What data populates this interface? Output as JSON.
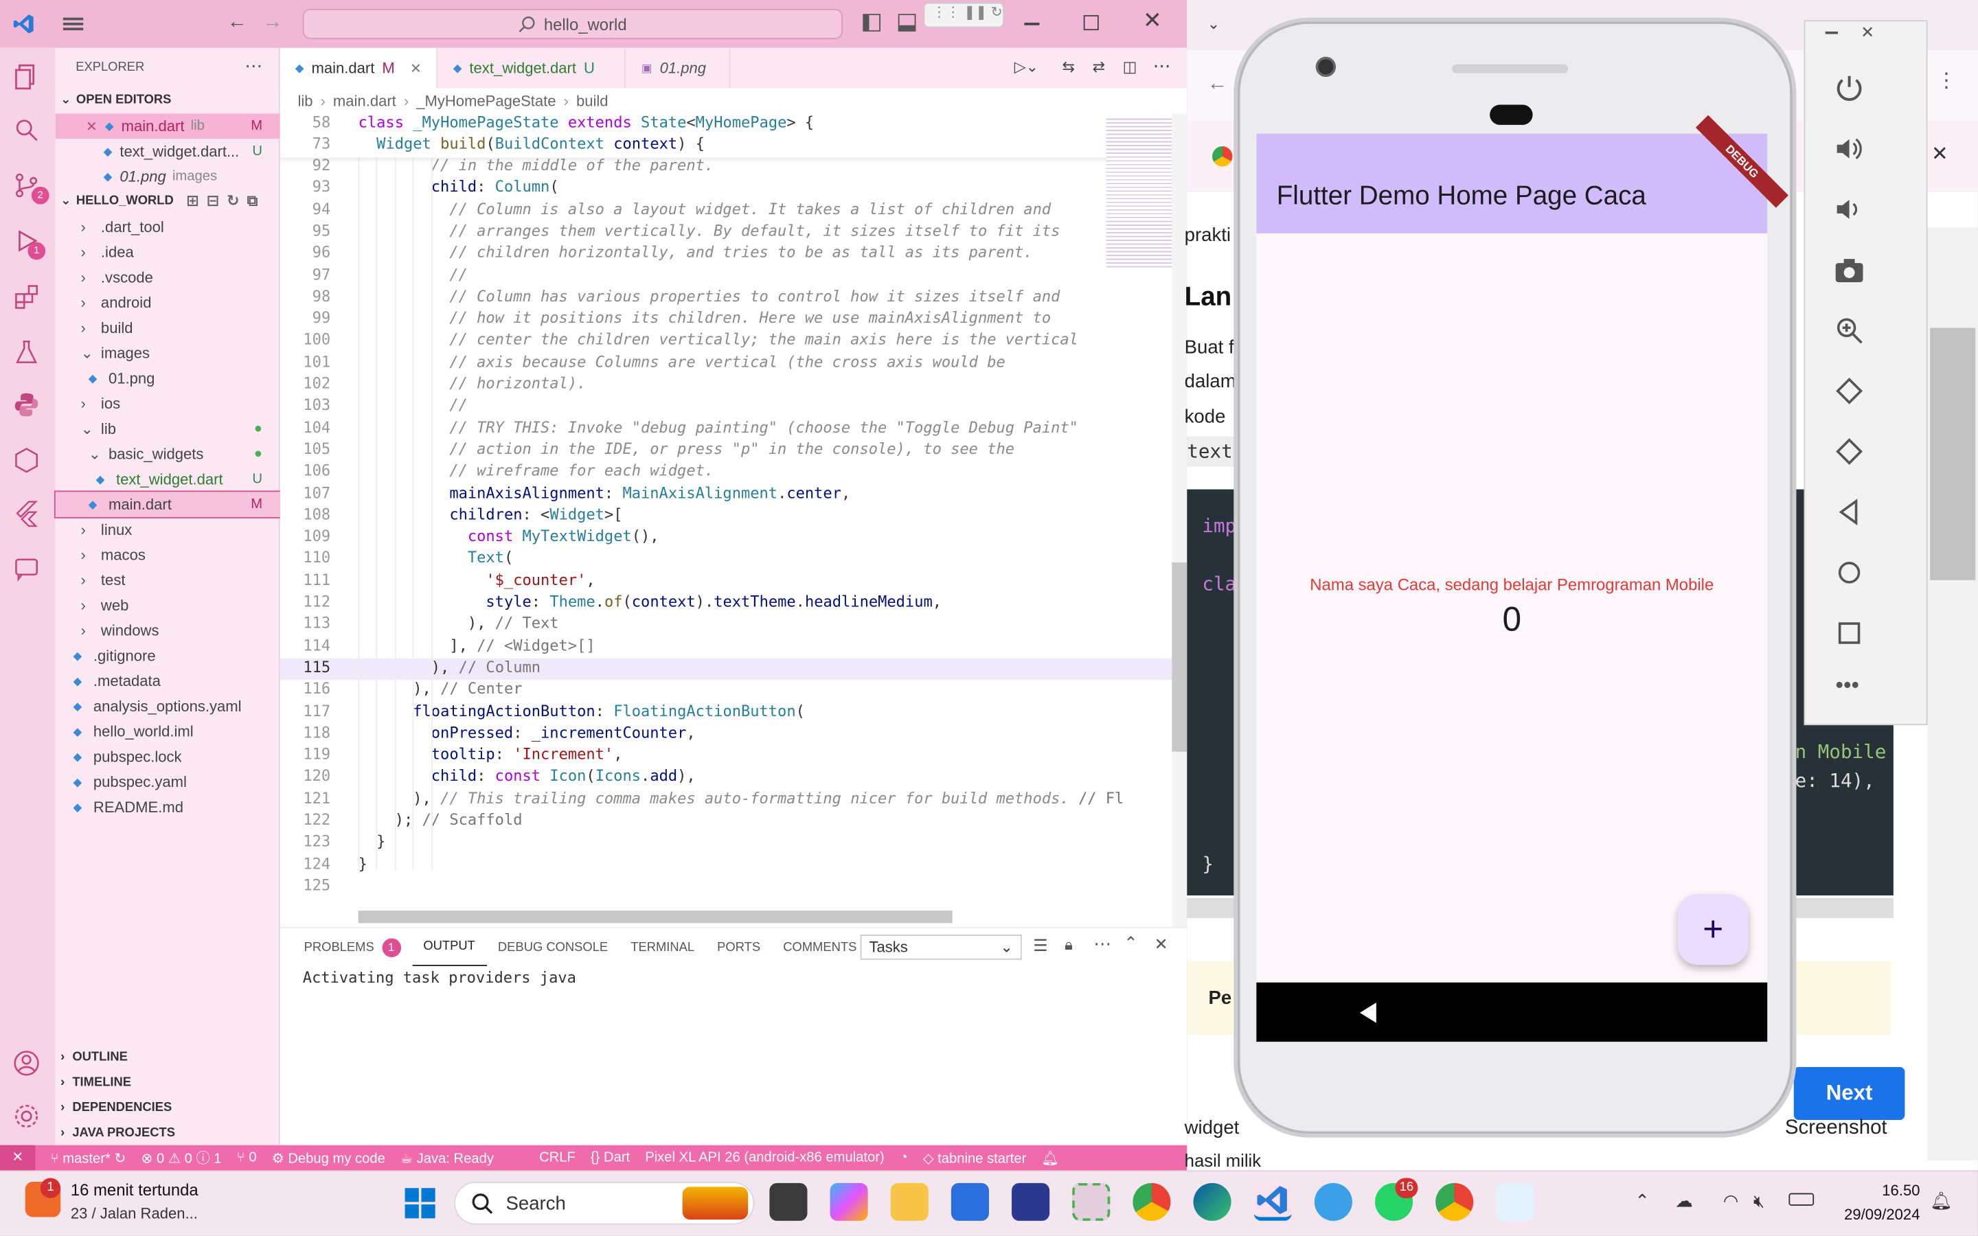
{
  "vscode": {
    "search_text": "hello_world",
    "explorer_title": "EXPLORER",
    "open_editors": {
      "title": "OPEN EDITORS",
      "items": [
        {
          "name": "main.dart",
          "folder": "lib",
          "decoration": "M"
        },
        {
          "name": "text_widget.dart...",
          "folder": "",
          "decoration": "U"
        },
        {
          "name": "01.png",
          "folder": "images",
          "decoration": ""
        }
      ]
    },
    "project": {
      "title": "HELLO_WORLD",
      "items": [
        {
          "name": ".dart_tool",
          "decoration": ""
        },
        {
          "name": ".idea",
          "decoration": ""
        },
        {
          "name": ".vscode",
          "decoration": ""
        },
        {
          "name": "android",
          "decoration": ""
        },
        {
          "name": "build",
          "decoration": ""
        },
        {
          "name": "images",
          "decoration": ""
        },
        {
          "name": "01.png",
          "decoration": ""
        },
        {
          "name": "ios",
          "decoration": ""
        },
        {
          "name": "lib",
          "decoration": "●"
        },
        {
          "name": "basic_widgets",
          "decoration": "●"
        },
        {
          "name": "text_widget.dart",
          "decoration": "U"
        },
        {
          "name": "main.dart",
          "decoration": "M"
        },
        {
          "name": "linux",
          "decoration": ""
        },
        {
          "name": "macos",
          "decoration": ""
        },
        {
          "name": "test",
          "decoration": ""
        },
        {
          "name": "web",
          "decoration": ""
        },
        {
          "name": "windows",
          "decoration": ""
        },
        {
          "name": ".gitignore",
          "decoration": ""
        },
        {
          "name": ".metadata",
          "decoration": ""
        },
        {
          "name": "analysis_options.yaml",
          "decoration": ""
        },
        {
          "name": "hello_world.iml",
          "decoration": ""
        },
        {
          "name": "pubspec.lock",
          "decoration": ""
        },
        {
          "name": "pubspec.yaml",
          "decoration": ""
        },
        {
          "name": "README.md",
          "decoration": ""
        }
      ]
    },
    "bottom_sections": [
      "OUTLINE",
      "TIMELINE",
      "DEPENDENCIES",
      "JAVA PROJECTS"
    ],
    "tabs": [
      {
        "label": "main.dart",
        "decoration": "M"
      },
      {
        "label": "text_widget.dart",
        "decoration": "U"
      },
      {
        "label": "01.png",
        "decoration": ""
      }
    ],
    "breadcrumbs": [
      "lib",
      "main.dart",
      "_MyHomePageState",
      "build"
    ],
    "sticky_lines": [
      {
        "num": "58",
        "html": "<span class='k'>class</span> <span class='ty'>_MyHomePageState</span> <span class='k'>extends</span> <span class='ty'>State</span>&lt;<span class='ty'>MyHomePage</span>&gt; {"
      },
      {
        "num": "73",
        "html": "  <span class='ty'>Widget</span> <span class='fn'>build</span>(<span class='ty'>BuildContext</span> <span class='pr'>context</span>) {"
      }
    ],
    "code_lines": [
      {
        "num": "92",
        "html": "        <span class='cm'>// in the middle of the parent.</span>"
      },
      {
        "num": "93",
        "html": "        <span class='pr'>child</span>: <span class='ty'>Column</span>("
      },
      {
        "num": "94",
        "html": "          <span class='cm'>// Column is also a layout widget. It takes a list of children and</span>"
      },
      {
        "num": "95",
        "html": "          <span class='cm'>// arranges them vertically. By default, it sizes itself to fit its</span>"
      },
      {
        "num": "96",
        "html": "          <span class='cm'>// children horizontally, and tries to be as tall as its parent.</span>"
      },
      {
        "num": "97",
        "html": "          <span class='cm'>//</span>"
      },
      {
        "num": "98",
        "html": "          <span class='cm'>// Column has various properties to control how it sizes itself and</span>"
      },
      {
        "num": "99",
        "html": "          <span class='cm'>// how it positions its children. Here we use mainAxisAlignment to</span>"
      },
      {
        "num": "100",
        "html": "          <span class='cm'>// center the children vertically; the main axis here is the vertical</span>"
      },
      {
        "num": "101",
        "html": "          <span class='cm'>// axis because Columns are vertical (the cross axis would be</span>"
      },
      {
        "num": "102",
        "html": "          <span class='cm'>// horizontal).</span>"
      },
      {
        "num": "103",
        "html": "          <span class='cm'>//</span>"
      },
      {
        "num": "104",
        "html": "          <span class='cm'>// TRY THIS: Invoke \"debug painting\" (choose the \"Toggle Debug Paint\"</span>"
      },
      {
        "num": "105",
        "html": "          <span class='cm'>// action in the IDE, or press \"p\" in the console), to see the</span>"
      },
      {
        "num": "106",
        "html": "          <span class='cm'>// wireframe for each widget.</span>"
      },
      {
        "num": "107",
        "html": "          <span class='pr'>mainAxisAlignment</span>: <span class='ty'>MainAxisAlignment</span>.<span class='pr'>center</span>,"
      },
      {
        "num": "108",
        "html": "          <span class='pr'>children</span>: &lt;<span class='ty'>Widget</span>&gt;["
      },
      {
        "num": "109",
        "html": "            <span class='k'>const</span> <span class='ty'>MyTextWidget</span>(),"
      },
      {
        "num": "110",
        "html": "            <span class='ty'>Text</span>("
      },
      {
        "num": "111",
        "html": "              <span class='str'>'$_counter'</span>,"
      },
      {
        "num": "112",
        "html": "              <span class='pr'>style</span>: <span class='ty'>Theme</span>.<span class='fn'>of</span>(<span class='pr'>context</span>).<span class='pr'>textTheme</span>.<span class='pr'>headlineMedium</span>,"
      },
      {
        "num": "113",
        "html": "            ), <span class='cm' style='font-style:normal;color:#777'>// Text</span>"
      },
      {
        "num": "114",
        "html": "          ], <span class='cm' style='font-style:normal;color:#777'>// &lt;Widget&gt;[]</span>"
      },
      {
        "num": "115",
        "html": "        ), <span class='cm' style='font-style:normal;color:#777'>// Column</span>"
      },
      {
        "num": "116",
        "html": "      ), <span class='cm' style='font-style:normal;color:#777'>// Center</span>"
      },
      {
        "num": "117",
        "html": "      <span class='pr'>floatingActionButton</span>: <span class='ty'>FloatingActionButton</span>("
      },
      {
        "num": "118",
        "html": "        <span class='pr'>onPressed</span>: <span class='pr'>_incrementCounter</span>,"
      },
      {
        "num": "119",
        "html": "        <span class='pr'>tooltip</span>: <span class='str'>'Increment'</span>,"
      },
      {
        "num": "120",
        "html": "        <span class='pr'>child</span>: <span class='k'>const</span> <span class='ty'>Icon</span>(<span class='ty'>Icons</span>.<span class='pr'>add</span>),"
      },
      {
        "num": "121",
        "html": "      ), <span class='cm'>// This trailing comma makes auto-formatting nicer for build methods.</span> <span class='cm' style='font-style:normal;color:#777'>// Fl</span>"
      },
      {
        "num": "122",
        "html": "    ); <span class='cm' style='font-style:normal;color:#777'>// Scaffold</span>"
      },
      {
        "num": "123",
        "html": "  }"
      },
      {
        "num": "124",
        "html": "}"
      },
      {
        "num": "125",
        "html": ""
      }
    ],
    "panel": {
      "tabs": [
        "PROBLEMS",
        "OUTPUT",
        "DEBUG CONSOLE",
        "TERMINAL",
        "PORTS",
        "COMMENTS"
      ],
      "problems_count": "1",
      "tasks_select": "Tasks",
      "output_text": "Activating task providers java"
    },
    "status": {
      "branch": "master*",
      "errors": "0",
      "warnings": "0",
      "info": "1",
      "ports": "0",
      "debug": "Debug my code",
      "java": "Java: Ready",
      "eol": "CRLF",
      "language": "Dart",
      "device": "Pixel XL API 26 (android-x86 emulator)",
      "tabnine": "tabnine starter"
    }
  },
  "phone": {
    "app_title": "Flutter Demo Home Page Caca",
    "debug_banner": "DEBUG",
    "text_widget": "Nama saya Caca, sedang belajar Pemrograman Mobile",
    "counter": "0",
    "fab_label": "+"
  },
  "browser": {
    "fragments": [
      "prakti",
      "Lan",
      "Buat f",
      "dalam",
      "kode",
      "text",
      "Pe",
      "widget",
      "hasil milik"
    ],
    "code_fragments": [
      "imp",
      "cla",
      "n Mobile",
      "e: 14),",
      "}"
    ],
    "next_button": "Next",
    "screenshot_text": "Screenshot"
  },
  "taskbar": {
    "weather_title": "16 menit tertunda",
    "weather_sub": "23 / Jalan Raden...",
    "weather_badge": "1",
    "search_label": "Search",
    "whatsapp_badge": "16",
    "time": "16.50",
    "date": "29/09/2024"
  },
  "colors": {
    "vscode_accent": "#f06bac",
    "title_pink": "#f1b8d6",
    "appbar_purple": "#d0bcfb",
    "next_blue": "#1a73e8"
  }
}
